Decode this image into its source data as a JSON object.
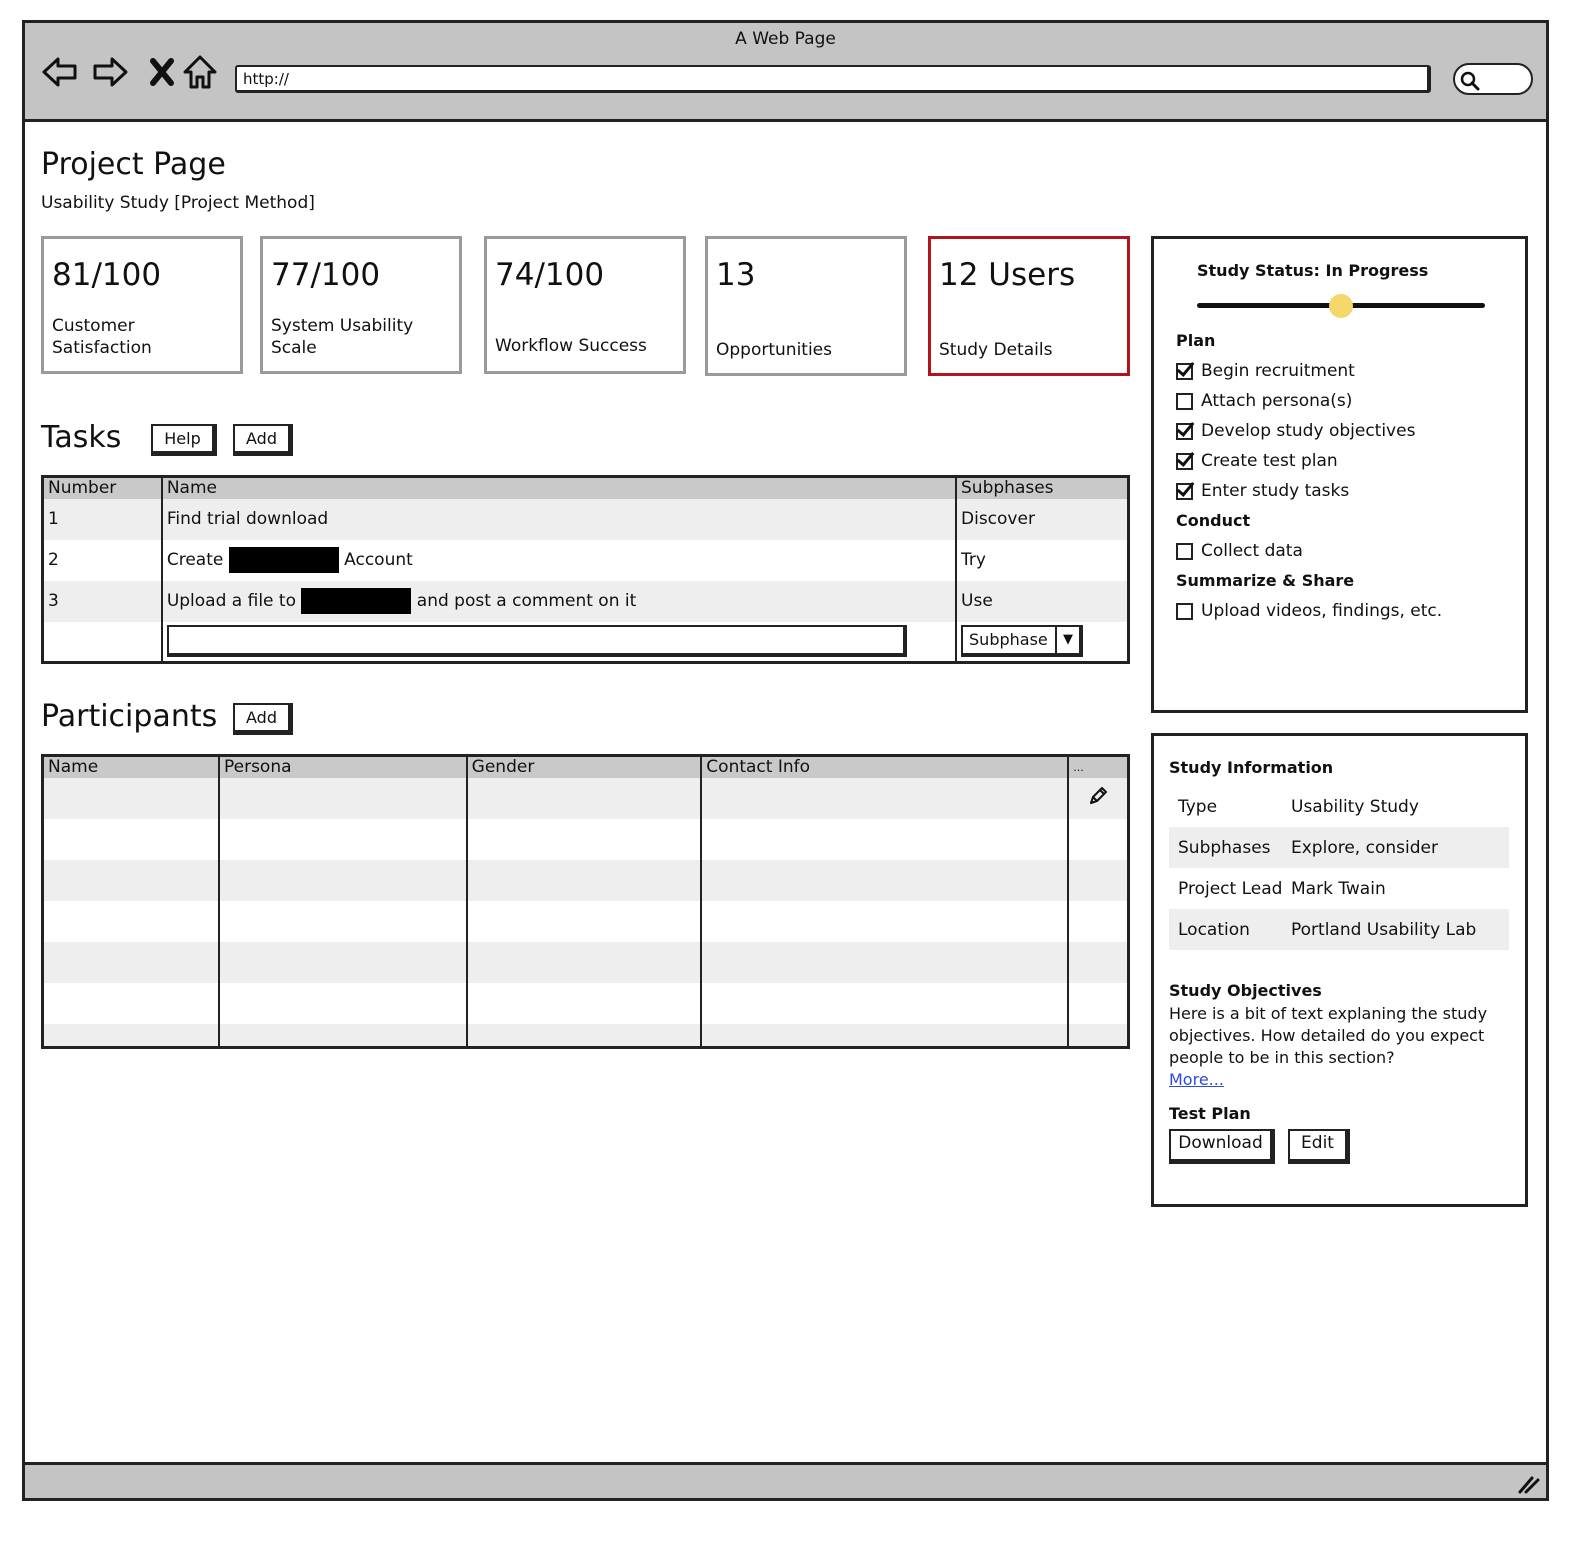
{
  "window": {
    "title": "A Web Page",
    "url": "http://"
  },
  "page": {
    "title": "Project Page",
    "subtitle": "Usability Study [Project Method]"
  },
  "metrics": [
    {
      "value": "81/100",
      "label": "Customer Satisfaction"
    },
    {
      "value": "77/100",
      "label": "System Usability Scale"
    },
    {
      "value": "74/100",
      "label": "Workflow Success"
    },
    {
      "value": "13",
      "label": "Opportunities"
    },
    {
      "value": "12 Users",
      "label": "Study Details"
    }
  ],
  "tasks": {
    "title": "Tasks",
    "help_label": "Help",
    "add_label": "Add",
    "columns": [
      "Number",
      "Name",
      "Subphases"
    ],
    "rows": [
      {
        "number": "1",
        "name": "Find trial download",
        "subphase": "Discover"
      },
      {
        "number": "2",
        "name_before": "Create",
        "name_after": "Account",
        "subphase": "Try"
      },
      {
        "number": "3",
        "name_before": "Upload a file to",
        "name_after": "and post a comment on it",
        "subphase": "Use"
      }
    ],
    "new_row": {
      "select_value": "Subphase"
    }
  },
  "participants": {
    "title": "Participants",
    "add_label": "Add",
    "columns": [
      "Name",
      "Persona",
      "Gender",
      "Contact Info",
      "..."
    ]
  },
  "study_status": {
    "title": "Study Status: In Progress",
    "progress": 0.5,
    "groups": [
      {
        "name": "Plan",
        "items": [
          {
            "label": "Begin recruitment",
            "checked": true
          },
          {
            "label": "Attach persona(s)",
            "checked": false
          },
          {
            "label": "Develop study objectives",
            "checked": true
          },
          {
            "label": "Create test plan",
            "checked": true
          },
          {
            "label": "Enter study tasks",
            "checked": true
          }
        ]
      },
      {
        "name": "Conduct",
        "items": [
          {
            "label": "Collect data",
            "checked": false
          }
        ]
      },
      {
        "name": "Summarize & Share",
        "items": [
          {
            "label": "Upload videos, findings, etc.",
            "checked": false
          }
        ]
      }
    ]
  },
  "study_info": {
    "title": "Study Information",
    "rows": [
      {
        "key": "Type",
        "value": "Usability Study"
      },
      {
        "key": "Subphases",
        "value": "Explore, consider"
      },
      {
        "key": "Project Lead",
        "value": "Mark Twain"
      },
      {
        "key": "Location",
        "value": "Portland Usability Lab"
      }
    ],
    "objectives_title": "Study Objectives",
    "objectives_text": "Here is a bit of text explaning the study objectives. How detailed do you expect people to be in this section?",
    "more_label": "More...",
    "test_plan_title": "Test Plan",
    "download_label": "Download",
    "edit_label": "Edit"
  },
  "colors": {
    "highlight_border": "#b0151b",
    "slider_knob": "#f5d76b",
    "link": "#2f4bd6"
  }
}
